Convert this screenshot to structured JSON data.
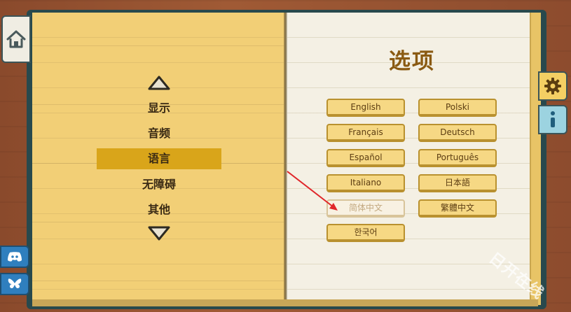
{
  "page": {
    "title": "选项"
  },
  "left_menu": {
    "items": [
      {
        "label": "显示",
        "active": false
      },
      {
        "label": "音频",
        "active": false
      },
      {
        "label": "语言",
        "active": true
      },
      {
        "label": "无障碍",
        "active": false
      },
      {
        "label": "其他",
        "active": false
      }
    ]
  },
  "languages": [
    {
      "label": "English",
      "state": "normal"
    },
    {
      "label": "Polski",
      "state": "normal"
    },
    {
      "label": "Français",
      "state": "normal"
    },
    {
      "label": "Deutsch",
      "state": "normal"
    },
    {
      "label": "Español",
      "state": "normal"
    },
    {
      "label": "Português",
      "state": "normal"
    },
    {
      "label": "Italiano",
      "state": "normal"
    },
    {
      "label": "日本語",
      "state": "normal"
    },
    {
      "label": "简体中文",
      "state": "selected"
    },
    {
      "label": "繁體中文",
      "state": "normal"
    },
    {
      "label": "한국어",
      "state": "normal"
    }
  ],
  "tabs": {
    "home_icon": "home-icon",
    "gear_icon": "gear-icon",
    "info_icon": "info-icon"
  },
  "social": {
    "discord_icon": "discord-icon",
    "bluesky_icon": "bluesky-icon"
  },
  "watermark": "日开在线",
  "colors": {
    "left_page": "#f2cf76",
    "right_page": "#f4f0e4",
    "active_menu": "#d9a51a",
    "title": "#8a5a12",
    "button": "#f6d884",
    "annotation_arrow": "#e0262a"
  }
}
